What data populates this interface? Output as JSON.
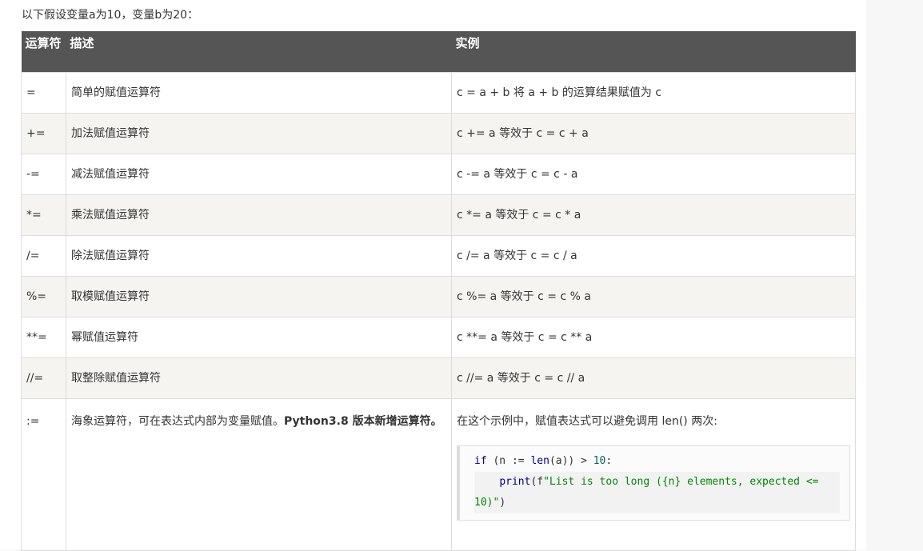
{
  "intro": "以下假设变量a为10，变量b为20：",
  "headers": {
    "operator": "运算符",
    "description": "描述",
    "example": "实例"
  },
  "rows": [
    {
      "op": "=",
      "desc": "简单的赋值运算符",
      "example": "c = a + b 将 a + b 的运算结果赋值为 c"
    },
    {
      "op": "+=",
      "desc": "加法赋值运算符",
      "example": "c += a 等效于 c = c + a"
    },
    {
      "op": "-=",
      "desc": "减法赋值运算符",
      "example": "c -= a 等效于 c = c - a"
    },
    {
      "op": "*=",
      "desc": "乘法赋值运算符",
      "example": "c *= a 等效于 c = c * a"
    },
    {
      "op": "/=",
      "desc": "除法赋值运算符",
      "example": "c /= a 等效于 c = c / a"
    },
    {
      "op": "%=",
      "desc": "取模赋值运算符",
      "example": "c %= a 等效于 c = c % a"
    },
    {
      "op": "**=",
      "desc": "幂赋值运算符",
      "example": "c **= a 等效于 c = c ** a"
    },
    {
      "op": "//=",
      "desc": "取整除赋值运算符",
      "example": "c //= a 等效于 c = c // a"
    }
  ],
  "walrus": {
    "op": ":=",
    "desc": "海象运算符，可在表达式内部为变量赋值。",
    "desc_bold": "Python3.8 版本新增运算符。",
    "example_text": "在这个示例中，赋值表达式可以避免调用 len() 两次:",
    "code": {
      "l1_kw": "if",
      "l1_a": " (n := ",
      "l1_fn": "len",
      "l1_b": "(a)) > ",
      "l1_num": "10",
      "l1_c": ":",
      "l2_indent": "    ",
      "l2_fn": "print",
      "l2_a": "(f",
      "l2_str": "\"List is too long ({n} elements, expected <= 10)\"",
      "l2_b": ")"
    }
  }
}
